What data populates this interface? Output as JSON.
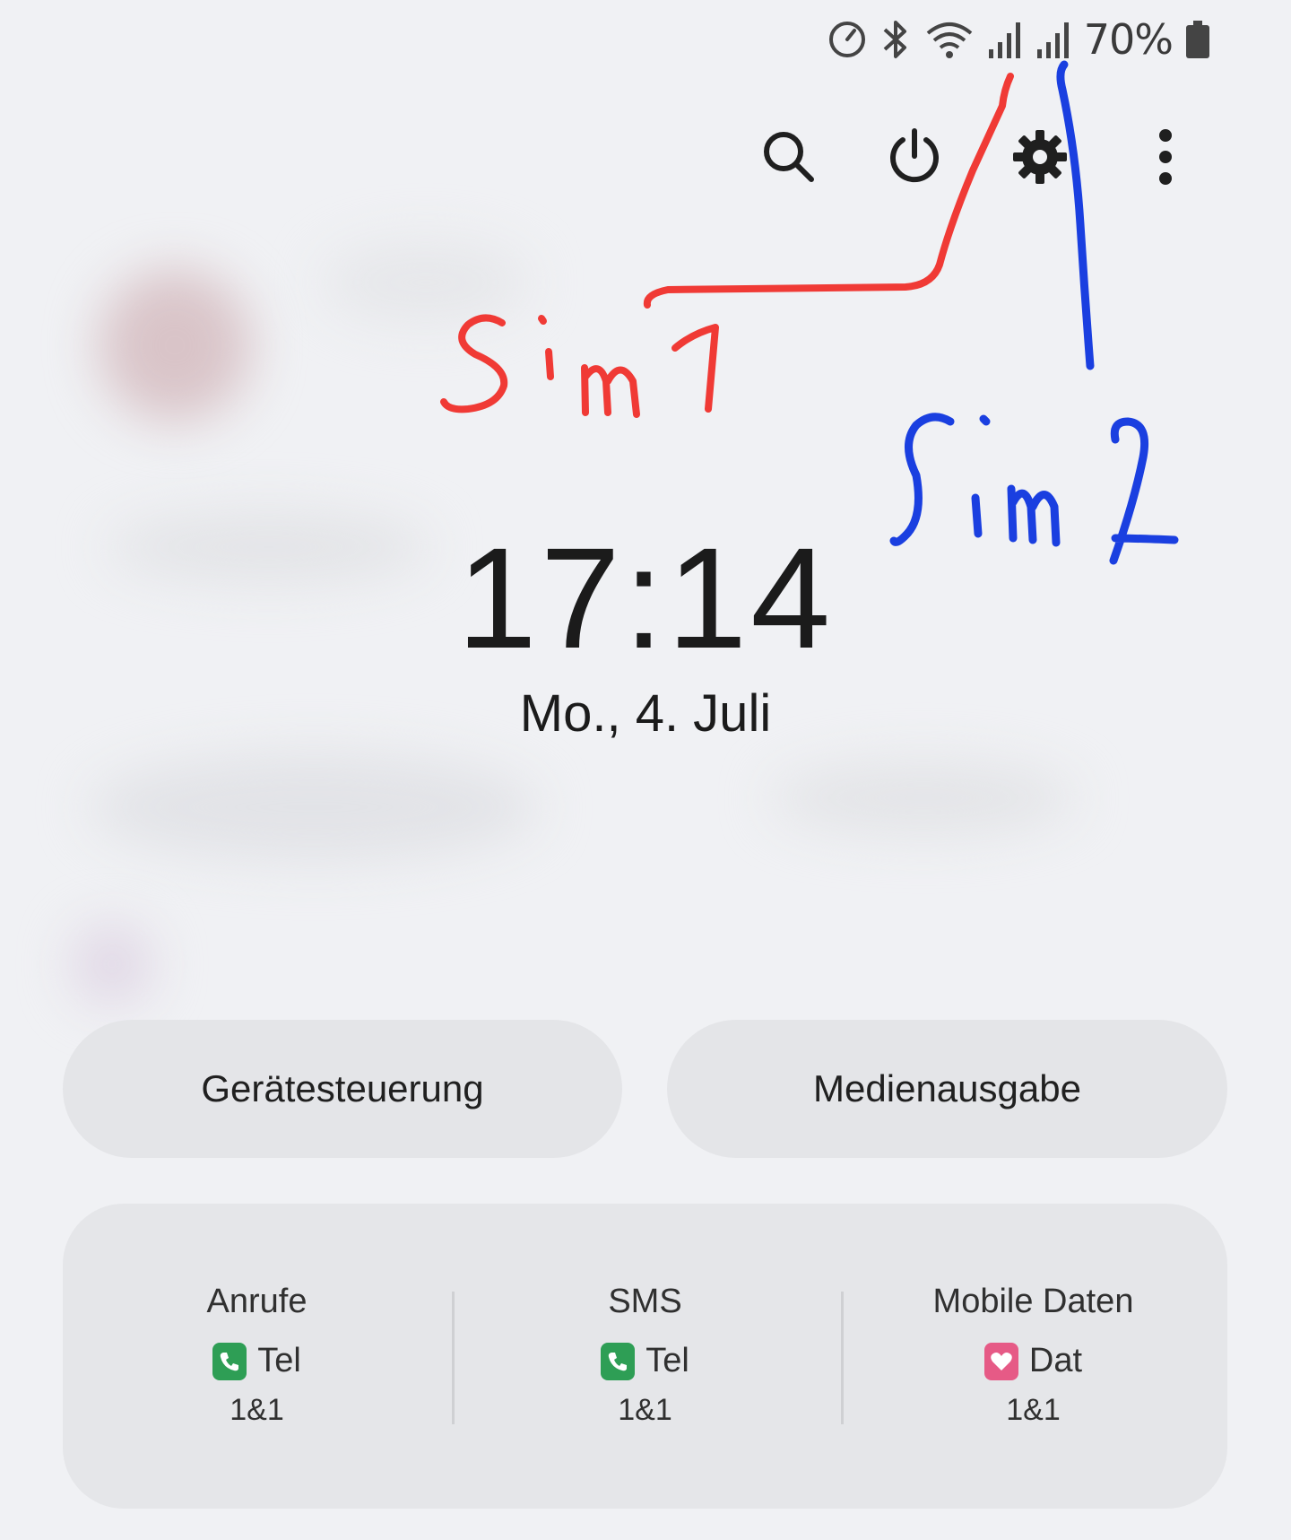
{
  "status_bar": {
    "battery_percent": "70%",
    "icons": [
      "speedometer-icon",
      "bluetooth-icon",
      "wifi-icon",
      "signal-sim1-icon",
      "signal-sim2-icon",
      "battery-icon"
    ]
  },
  "quick_panel": {
    "icons": [
      "search-icon",
      "power-icon",
      "settings-icon",
      "more-icon"
    ]
  },
  "clock": {
    "time": "17:14",
    "date": "Mo., 4. Juli"
  },
  "buttons": {
    "device_control": "Gerätesteuerung",
    "media_output": "Medienausgabe"
  },
  "sim_manager": {
    "columns": [
      {
        "title": "Anrufe",
        "sim_label": "Tel",
        "carrier": "1&1",
        "icon": "phone-icon",
        "icon_color": "#2e9e55"
      },
      {
        "title": "SMS",
        "sim_label": "Tel",
        "carrier": "1&1",
        "icon": "phone-icon",
        "icon_color": "#2e9e55"
      },
      {
        "title": "Mobile Daten",
        "sim_label": "Dat",
        "carrier": "1&1",
        "icon": "heart-icon",
        "icon_color": "#e65a86"
      }
    ]
  },
  "annotations": {
    "sim1": {
      "text": "Sim1",
      "color": "#f03a35"
    },
    "sim2": {
      "text": "Sim2",
      "color": "#1a3fe0"
    }
  }
}
